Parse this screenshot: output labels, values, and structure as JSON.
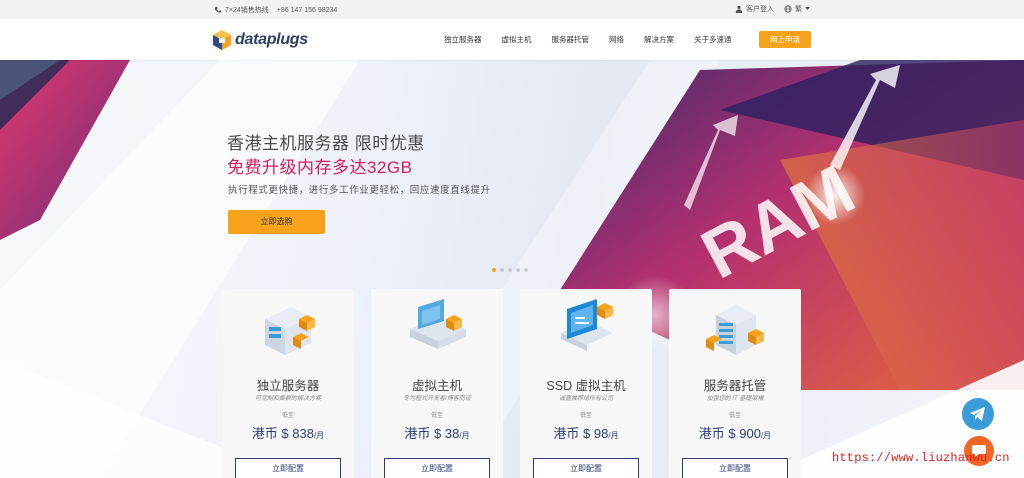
{
  "topbar": {
    "hotline_label": "7×24销售热线",
    "phone": "+86 147 156 98234",
    "login_label": "客户登入",
    "lang_label": "繁"
  },
  "nav": {
    "logo_text": "dataplugs",
    "items": [
      "独立服务器",
      "虚拟主机",
      "服务器托管",
      "网络",
      "解决方案",
      "关于多速通"
    ],
    "apply_label": "网上申请"
  },
  "hero": {
    "title": "香港主机服务器 限时优惠",
    "subtitle": "免费升级内存多达32GB",
    "description": "执行程式更快捷，进行多工作业更轻松，回应速度直线提升",
    "button_label": "立即选购",
    "slide_count": 5,
    "active_slide": 1,
    "art_text": "RAM"
  },
  "cards": [
    {
      "title": "独立服务器",
      "desc": "可完制和集群的解决方案",
      "low": "低至",
      "price": "港币 $ 838",
      "unit": "/月",
      "button": "立即配置",
      "icon": "dedicated-server-icon"
    },
    {
      "title": "虚拟主机",
      "desc": "专为程式开发者/博客而设",
      "low": "低至",
      "price": "港币 $ 38",
      "unit": "/月",
      "button": "立即配置",
      "icon": "virtual-host-icon"
    },
    {
      "title": "SSD 虚拟主机",
      "desc": "诚嘉推荐给所有公司",
      "low": "低至",
      "price": "港币 $ 98",
      "unit": "/月",
      "button": "立即配置",
      "icon": "ssd-virtual-host-icon"
    },
    {
      "title": "服务器托管",
      "desc": "加强您的 IT 基礎架構",
      "low": "低至",
      "price": "港币 $ 900",
      "unit": "/月",
      "button": "立即配置",
      "icon": "colocation-icon"
    }
  ],
  "watermark": "https://www.liuzhanwu.cn",
  "colors": {
    "accent": "#f6a21b",
    "brand": "#2c3e7a",
    "highlight": "#d81b60",
    "telegram": "#3a9bd9",
    "chat": "#f26522"
  }
}
